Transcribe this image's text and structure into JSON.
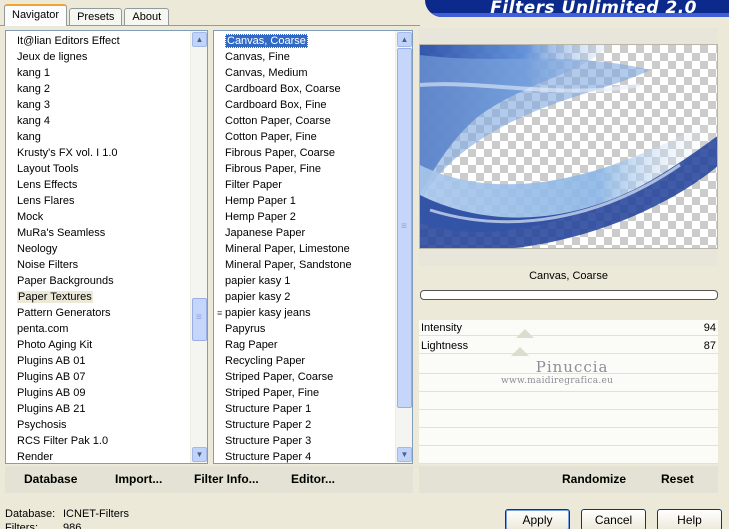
{
  "tabs": [
    "Navigator",
    "Presets",
    "About"
  ],
  "banner": "Filters Unlimited 2.0",
  "categories": {
    "items": [
      "It@lian Editors Effect",
      "Jeux de lignes",
      "kang 1",
      "kang 2",
      "kang 3",
      "kang 4",
      "kang",
      "Krusty's FX vol. I 1.0",
      "Layout Tools",
      "Lens Effects",
      "Lens Flares",
      "Mock",
      "MuRa's Seamless",
      "Neology",
      "Noise Filters",
      "Paper Backgrounds",
      "Paper Textures",
      "Pattern Generators",
      "penta.com",
      "Photo Aging Kit",
      "Plugins AB 01",
      "Plugins AB 07",
      "Plugins AB 09",
      "Plugins AB 21",
      "Psychosis",
      "RCS Filter Pak 1.0",
      "Render"
    ],
    "selected_index": 16,
    "scroll_position": 0.7
  },
  "filters": {
    "items": [
      "Canvas, Coarse",
      "Canvas, Fine",
      "Canvas, Medium",
      "Cardboard Box, Coarse",
      "Cardboard Box, Fine",
      "Cotton Paper, Coarse",
      "Cotton Paper, Fine",
      "Fibrous Paper, Coarse",
      "Fibrous Paper, Fine",
      "Filter Paper",
      "Hemp Paper 1",
      "Hemp Paper 2",
      "Japanese Paper",
      "Mineral Paper, Limestone",
      "Mineral Paper, Sandstone",
      "papier kasy 1",
      "papier kasy 2",
      "papier kasy jeans",
      "Papyrus",
      "Rag Paper",
      "Recycling Paper",
      "Striped Paper, Coarse",
      "Striped Paper, Fine",
      "Structure Paper 1",
      "Structure Paper 2",
      "Structure Paper 3",
      "Structure Paper 4"
    ],
    "selected_index": 0,
    "marker_index": 17,
    "scroll_position": 0.0
  },
  "preview": {
    "filter_name": "Canvas, Coarse"
  },
  "sliders": [
    {
      "label": "Intensity",
      "value": "94"
    },
    {
      "label": "Lightness",
      "value": "87"
    }
  ],
  "watermark": {
    "line1": "Pinuccia",
    "line2": "www.maidiregrafica.eu"
  },
  "toolbar_left": {
    "database": "Database",
    "import": "Import...",
    "filter_info": "Filter Info...",
    "editor": "Editor..."
  },
  "toolbar_right": {
    "randomize": "Randomize",
    "reset": "Reset"
  },
  "status": {
    "database_label": "Database:",
    "database_value": "ICNET-Filters",
    "filters_label": "Filters:",
    "filters_value": "986"
  },
  "buttons": {
    "apply": "Apply",
    "cancel": "Cancel",
    "help": "Help"
  },
  "colors": {
    "selection": "#316ac5",
    "banner": "#0b2a8c",
    "face": "#ece9d8"
  }
}
